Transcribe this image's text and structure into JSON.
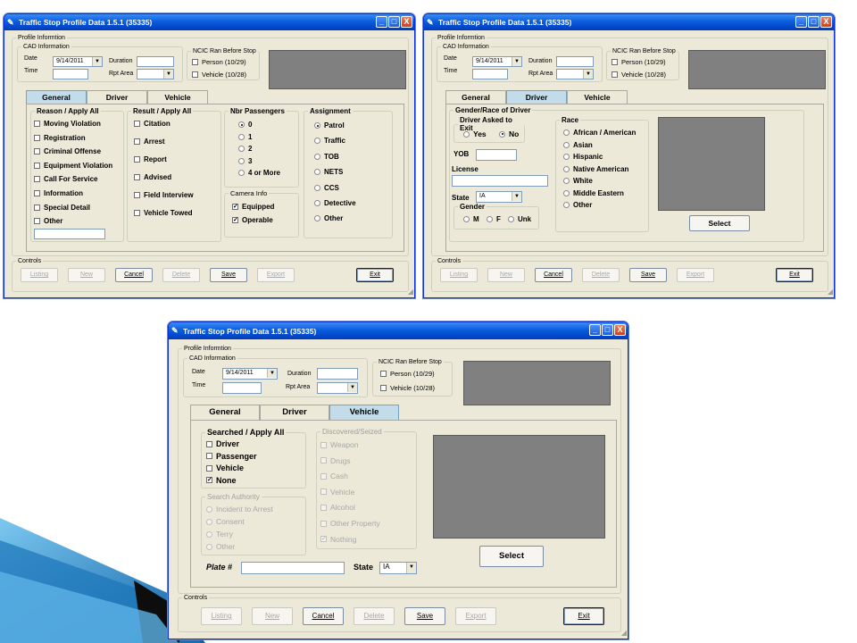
{
  "window": {
    "title": "Traffic Stop Profile Data 1.5.1  (35335)",
    "buttons": {
      "minimize": "_",
      "maximize": "□",
      "close": "X"
    }
  },
  "profile": {
    "legend": "Profile Informtion",
    "cad": {
      "legend": "CAD Information",
      "date_label": "Date",
      "date_value": "9/14/2011",
      "time_label": "Time",
      "time_value": "",
      "duration_label": "Duration",
      "duration_value": "",
      "rpt_area_label": "Rpt Area",
      "rpt_area_value": ""
    },
    "ncic": {
      "legend": "NCIC Ran Before Stop",
      "person_label": "Person (10/29)",
      "vehicle_label": "Vehicle (10/28)"
    }
  },
  "tabs": {
    "general": "General",
    "driver": "Driver",
    "vehicle": "Vehicle"
  },
  "general": {
    "reason": {
      "legend": "Reason / Apply All",
      "items": [
        "Moving Violation",
        "Registration",
        "Criminal Offense",
        "Equipment Violation",
        "Call For Service",
        "Information",
        "Special Detail",
        "Other"
      ]
    },
    "result": {
      "legend": "Result / Apply All",
      "items": [
        "Citation",
        "Arrest",
        "Report",
        "Advised",
        "Field Interview",
        "Vehicle Towed"
      ]
    },
    "passengers": {
      "legend": "Nbr Passengers",
      "items": [
        "0",
        "1",
        "2",
        "3",
        "4 or More"
      ],
      "selected": "0"
    },
    "camera": {
      "legend": "Camera Info",
      "items": [
        "Equipped",
        "Operable"
      ],
      "checked": [
        "Equipped",
        "Operable"
      ]
    },
    "assignment": {
      "legend": "Assignment",
      "items": [
        "Patrol",
        "Traffic",
        "TOB",
        "NETS",
        "CCS",
        "Detective",
        "Other"
      ],
      "selected": "Patrol"
    }
  },
  "driver": {
    "legend": "Gender/Race of Driver",
    "asked": {
      "legend": "Driver Asked to Exit",
      "yes": "Yes",
      "no": "No",
      "selected": "No"
    },
    "yob_label": "YOB",
    "license_label": "License",
    "state_label": "State",
    "state_value": "IA",
    "gender": {
      "legend": "Gender",
      "items": [
        "M",
        "F",
        "Unk"
      ]
    },
    "race": {
      "legend": "Race",
      "items": [
        "African / American",
        "Asian",
        "Hispanic",
        "Native American",
        "White",
        "Middle Eastern",
        "Other"
      ]
    },
    "select_label": "Select"
  },
  "vehicle": {
    "searched": {
      "legend": "Searched / Apply All",
      "items": [
        "Driver",
        "Passenger",
        "Vehicle",
        "None"
      ],
      "checked": [
        "None"
      ]
    },
    "authority": {
      "legend": "Search Authority",
      "items": [
        "Incident to Arrest",
        "Consent",
        "Terry",
        "Other"
      ]
    },
    "discovered": {
      "legend": "Discovered/Seized",
      "items": [
        "Weapon",
        "Drugs",
        "Cash",
        "Vehicle",
        "Alcohol",
        "Other Property",
        "Nothing"
      ],
      "checked": [
        "Nothing"
      ]
    },
    "plate_label": "Plate #",
    "state_label": "State",
    "state_value": "IA",
    "select_label": "Select"
  },
  "controls": {
    "legend": "Controls",
    "listing": "Listing",
    "new": "New",
    "cancel": "Cancel",
    "delete": "Delete",
    "save": "Save",
    "export": "Export",
    "exit": "Exit"
  },
  "colors": {
    "title_bar": "#0a5ddc",
    "dialog_bg": "#ece9d8",
    "active_tab": "#c3dcea",
    "image_placeholder": "#808080",
    "decor_blue": "#1a7fc4"
  }
}
